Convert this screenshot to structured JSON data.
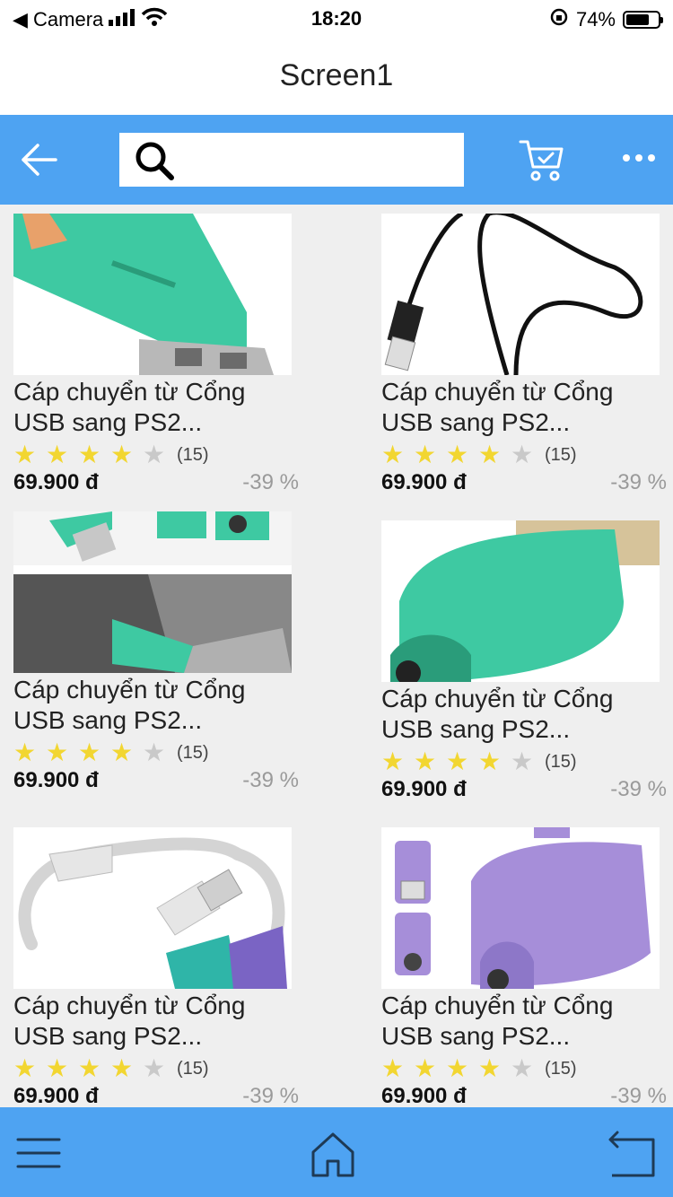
{
  "status": {
    "back_label": "◀ Camera",
    "time": "18:20",
    "battery": "74%",
    "battery_level": 0.74
  },
  "header": {
    "title": "Screen1"
  },
  "search": {
    "placeholder": "",
    "value": ""
  },
  "colors": {
    "primary": "#4ea3f2",
    "star": "#f2d631",
    "teal": "#3ec9a2",
    "purple": "#a68ed9"
  },
  "products": [
    {
      "name": "Cáp chuyển từ Cổng USB sang PS2...",
      "name_line1": "Cáp chuyển từ Cổng",
      "name_line2": "USB sang PS2...",
      "rating": 4,
      "reviews": "(15)",
      "price": "69.900 đ",
      "discount": "-39 %",
      "image": "teal-adapter-closeup"
    },
    {
      "name": "Cáp chuyển từ Cổng USB sang PS2...",
      "name_line1": "Cáp chuyển từ Cổng",
      "name_line2": "USB sang PS2...",
      "rating": 4,
      "reviews": "(15)",
      "price": "69.900 đ",
      "discount": "-39 %",
      "image": "black-usb-cable"
    },
    {
      "name": "Cáp chuyển từ Cổng USB sang PS2...",
      "name_line1": "Cáp chuyển từ Cổng",
      "name_line2": "USB sang PS2...",
      "rating": 4,
      "reviews": "(15)",
      "price": "69.900 đ",
      "discount": "-39 %",
      "image": "teal-adapter-plugged"
    },
    {
      "name": "Cáp chuyển từ Cổng USB sang PS2...",
      "name_line1": "Cáp chuyển từ Cổng",
      "name_line2": "USB sang PS2...",
      "rating": 4,
      "reviews": "(15)",
      "price": "69.900 đ",
      "discount": "-39 %",
      "image": "teal-adapter-side"
    },
    {
      "name": "Cáp chuyển từ Cổng USB sang PS2...",
      "name_line1": "Cáp chuyển từ Cổng",
      "name_line2": "USB sang PS2...",
      "rating": 4,
      "reviews": "(15)",
      "price": "69.900 đ",
      "discount": "-39 %",
      "image": "white-y-splitter"
    },
    {
      "name": "Cáp chuyển từ Cổng USB sang PS2...",
      "name_line1": "Cáp chuyển từ Cổng",
      "name_line2": "USB sang PS2...",
      "rating": 4,
      "reviews": "(15)",
      "price": "69.900 đ",
      "discount": "-39 %",
      "image": "purple-adapter"
    }
  ],
  "icons": {
    "back": "arrow-left-icon",
    "search": "search-icon",
    "cart": "cart-icon",
    "more": "more-icon",
    "menu": "menu-icon",
    "home": "home-icon",
    "return": "return-icon"
  }
}
